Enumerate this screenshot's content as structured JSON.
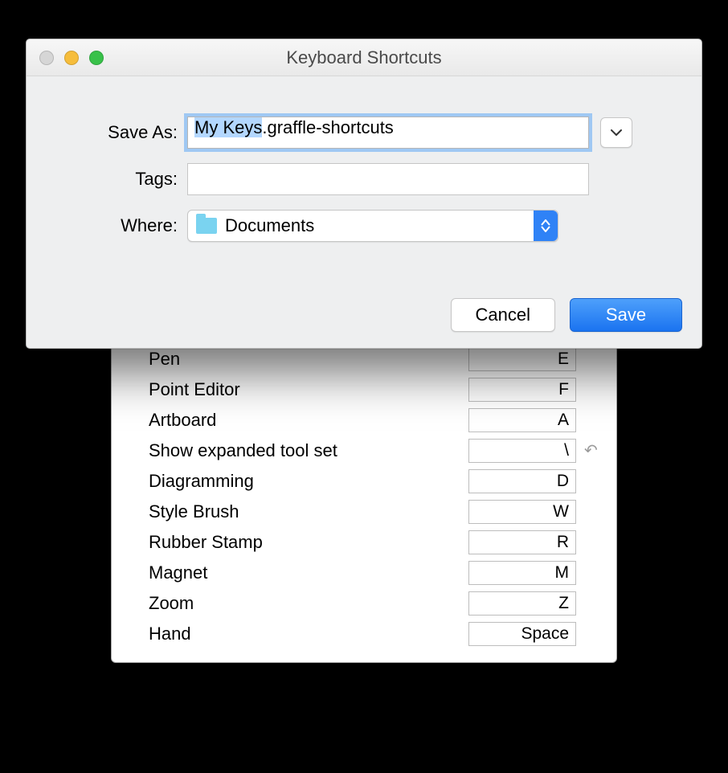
{
  "titlebar": {
    "title": "Keyboard Shortcuts"
  },
  "form": {
    "save_as_label": "Save As:",
    "tags_label": "Tags:",
    "where_label": "Where:",
    "filename_selected": "My Keys",
    "filename_rest": ".graffle-shortcuts",
    "where_value": "Documents"
  },
  "buttons": {
    "cancel": "Cancel",
    "save": "Save"
  },
  "shortcuts": [
    {
      "label": "Pen",
      "key": "E",
      "undo": false
    },
    {
      "label": "Point Editor",
      "key": "F",
      "undo": false
    },
    {
      "label": "Artboard",
      "key": "A",
      "undo": false
    },
    {
      "label": "Show expanded tool set",
      "key": "\\",
      "undo": true
    },
    {
      "label": "Diagramming",
      "key": "D",
      "undo": false
    },
    {
      "label": "Style Brush",
      "key": "W",
      "undo": false
    },
    {
      "label": "Rubber Stamp",
      "key": "R",
      "undo": false
    },
    {
      "label": "Magnet",
      "key": "M",
      "undo": false
    },
    {
      "label": "Zoom",
      "key": "Z",
      "undo": false
    },
    {
      "label": "Hand",
      "key": "Space",
      "undo": false
    }
  ]
}
